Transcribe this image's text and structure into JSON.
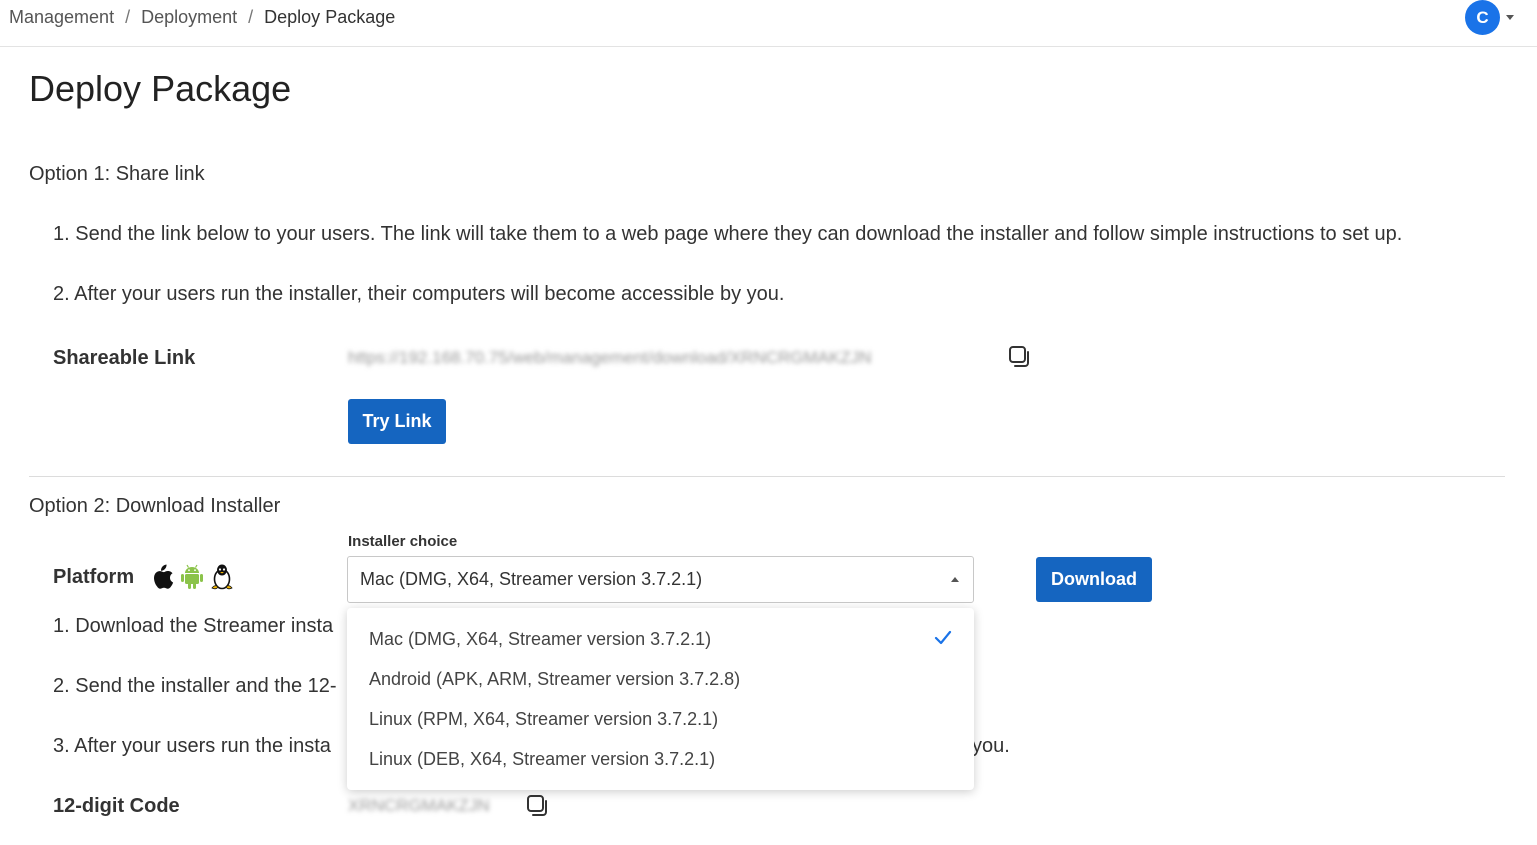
{
  "breadcrumb": {
    "items": [
      "Management",
      "Deployment",
      "Deploy Package"
    ]
  },
  "user": {
    "avatar_initial": "C"
  },
  "page": {
    "title": "Deploy Package"
  },
  "option1": {
    "title": "Option 1: Share link",
    "step1": "1. Send the link below to your users. The link will take them to a web page where they can download the installer and follow simple instructions to set up.",
    "step2": "2. After your users run the installer, their computers will become accessible by you.",
    "shareable_link_label": "Shareable Link",
    "shareable_link_value": "https://192.168.70.75/web/management/download/XRNCRGMAKZJN",
    "try_link_button": "Try Link"
  },
  "option2": {
    "title": "Option 2: Download Installer",
    "platform_label": "Platform",
    "platform_icons": [
      "apple-icon",
      "android-icon",
      "linux-icon"
    ],
    "installer_choice_label": "Installer choice",
    "selected_installer": "Mac (DMG, X64, Streamer version 3.7.2.1)",
    "download_button": "Download",
    "step1_visible": "1. Download the Streamer insta",
    "step2_visible": "2. Send the installer and the 12-",
    "step3_visible": "3. After your users run the insta",
    "step3_tail": "you.",
    "code_label": "12-digit Code",
    "code_value": "XRNCRGMAKZJN",
    "installer_options": [
      {
        "label": "Mac (DMG, X64, Streamer version 3.7.2.1)",
        "selected": true
      },
      {
        "label": "Android (APK, ARM, Streamer version 3.7.2.8)",
        "selected": false
      },
      {
        "label": "Linux (RPM, X64, Streamer version 3.7.2.1)",
        "selected": false
      },
      {
        "label": "Linux (DEB, X64, Streamer version 3.7.2.1)",
        "selected": false
      }
    ]
  },
  "colors": {
    "primary": "#1565c0",
    "avatar": "#1a73e8",
    "android": "#8bc34a"
  }
}
